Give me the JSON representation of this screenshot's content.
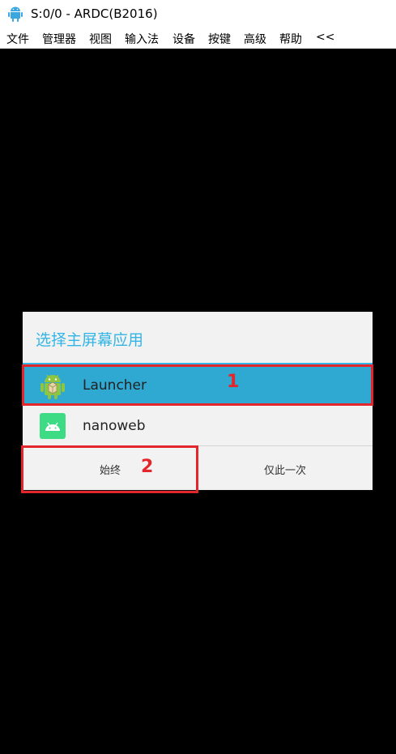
{
  "window": {
    "title": "S:0/0 - ARDC(B2016)",
    "icon": "android-icon"
  },
  "menubar": {
    "items": [
      "文件",
      "管理器",
      "视图",
      "输入法",
      "设备",
      "按键",
      "高级",
      "帮助",
      "<<"
    ]
  },
  "dialog": {
    "title": "选择主屏幕应用",
    "accent_color": "#33b5e5",
    "selected_color": "#2fa8d2",
    "items": [
      {
        "label": "Launcher",
        "icon": "launcher-android-icon",
        "selected": true
      },
      {
        "label": "nanoweb",
        "icon": "nanoweb-android-icon",
        "selected": false
      }
    ],
    "buttons": {
      "always": "始终",
      "just_once": "仅此一次"
    }
  },
  "annotations": {
    "color": "#e3262b",
    "marker_1": "1",
    "marker_2": "2"
  }
}
